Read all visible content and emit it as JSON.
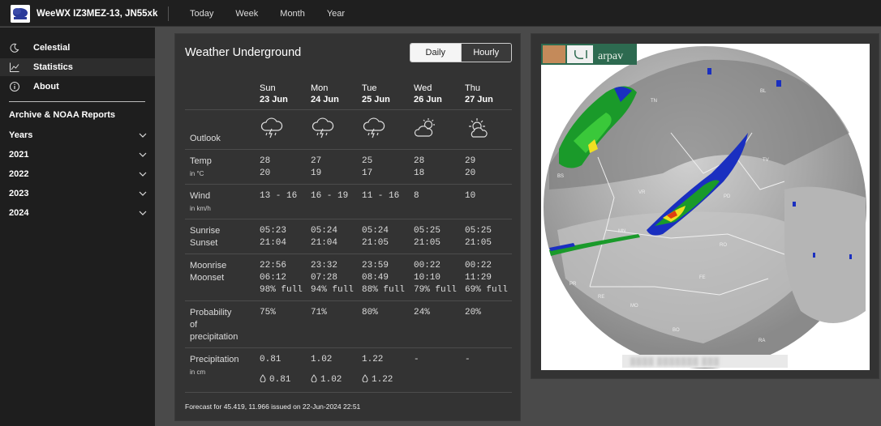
{
  "brand": {
    "name": "WeeWX IZ3MEZ-13, JN55xk"
  },
  "nav": [
    "Today",
    "Week",
    "Month",
    "Year"
  ],
  "sidebar": {
    "items": [
      {
        "label": "Celestial",
        "icon": "moon-icon"
      },
      {
        "label": "Statistics",
        "icon": "chart-icon"
      },
      {
        "label": "About",
        "icon": "info-icon"
      }
    ],
    "section_title": "Archive & NOAA Reports",
    "accordion": [
      "Years",
      "2021",
      "2022",
      "2023",
      "2024"
    ]
  },
  "forecast": {
    "title": "Weather Underground",
    "toggle": {
      "daily": "Daily",
      "hourly": "Hourly"
    },
    "days": [
      {
        "day": "Sun",
        "date": "23 Jun"
      },
      {
        "day": "Mon",
        "date": "24 Jun"
      },
      {
        "day": "Tue",
        "date": "25 Jun"
      },
      {
        "day": "Wed",
        "date": "26 Jun"
      },
      {
        "day": "Thu",
        "date": "27 Jun"
      }
    ],
    "labels": {
      "outlook": "Outlook",
      "temp": "Temp",
      "temp_unit": "in °C",
      "wind": "Wind",
      "wind_unit": "in km/h",
      "sunrise": "Sunrise",
      "sunset": "Sunset",
      "moonrise": "Moonrise",
      "moonset": "Moonset",
      "pop": [
        "Probability",
        "of",
        "precipitation"
      ],
      "precip": "Precipitation",
      "precip_unit": "in cm"
    },
    "outlook_icons": [
      "thunderstorm-icon",
      "thunderstorm-icon",
      "thunderstorm-icon",
      "partly-cloudy-icon",
      "partly-cloudy-icon"
    ],
    "temp_high": [
      "28",
      "27",
      "25",
      "28",
      "29"
    ],
    "temp_low": [
      "20",
      "19",
      "17",
      "18",
      "20"
    ],
    "wind": [
      "13 - 16",
      "16 - 19",
      "11 - 16",
      "8",
      "10"
    ],
    "sunrise": [
      "05:23",
      "05:24",
      "05:24",
      "05:25",
      "05:25"
    ],
    "sunset": [
      "21:04",
      "21:04",
      "21:05",
      "21:05",
      "21:05"
    ],
    "moonrise": [
      "22:56",
      "23:32",
      "23:59",
      "00:22",
      "00:22"
    ],
    "moonset": [
      "06:12",
      "07:28",
      "08:49",
      "10:10",
      "11:29"
    ],
    "moon_phase": [
      "98% full",
      "94% full",
      "88% full",
      "79% full",
      "69% full"
    ],
    "pop": [
      "75%",
      "71%",
      "80%",
      "24%",
      "20%"
    ],
    "precip": [
      "0.81",
      "1.02",
      "1.22",
      "-",
      "-"
    ],
    "precip_drops": [
      "0.81",
      "1.02",
      "1.22"
    ],
    "footer": "Forecast for 45.419, 11.966 issued on 22-Jun-2024 22:51"
  },
  "radar": {
    "logo_text": "arpav",
    "city_labels": [
      "TN",
      "BL",
      "TV",
      "VR",
      "PD",
      "MN",
      "RO",
      "FE",
      "BS",
      "PR",
      "RE",
      "MO",
      "BO",
      "RA"
    ]
  }
}
